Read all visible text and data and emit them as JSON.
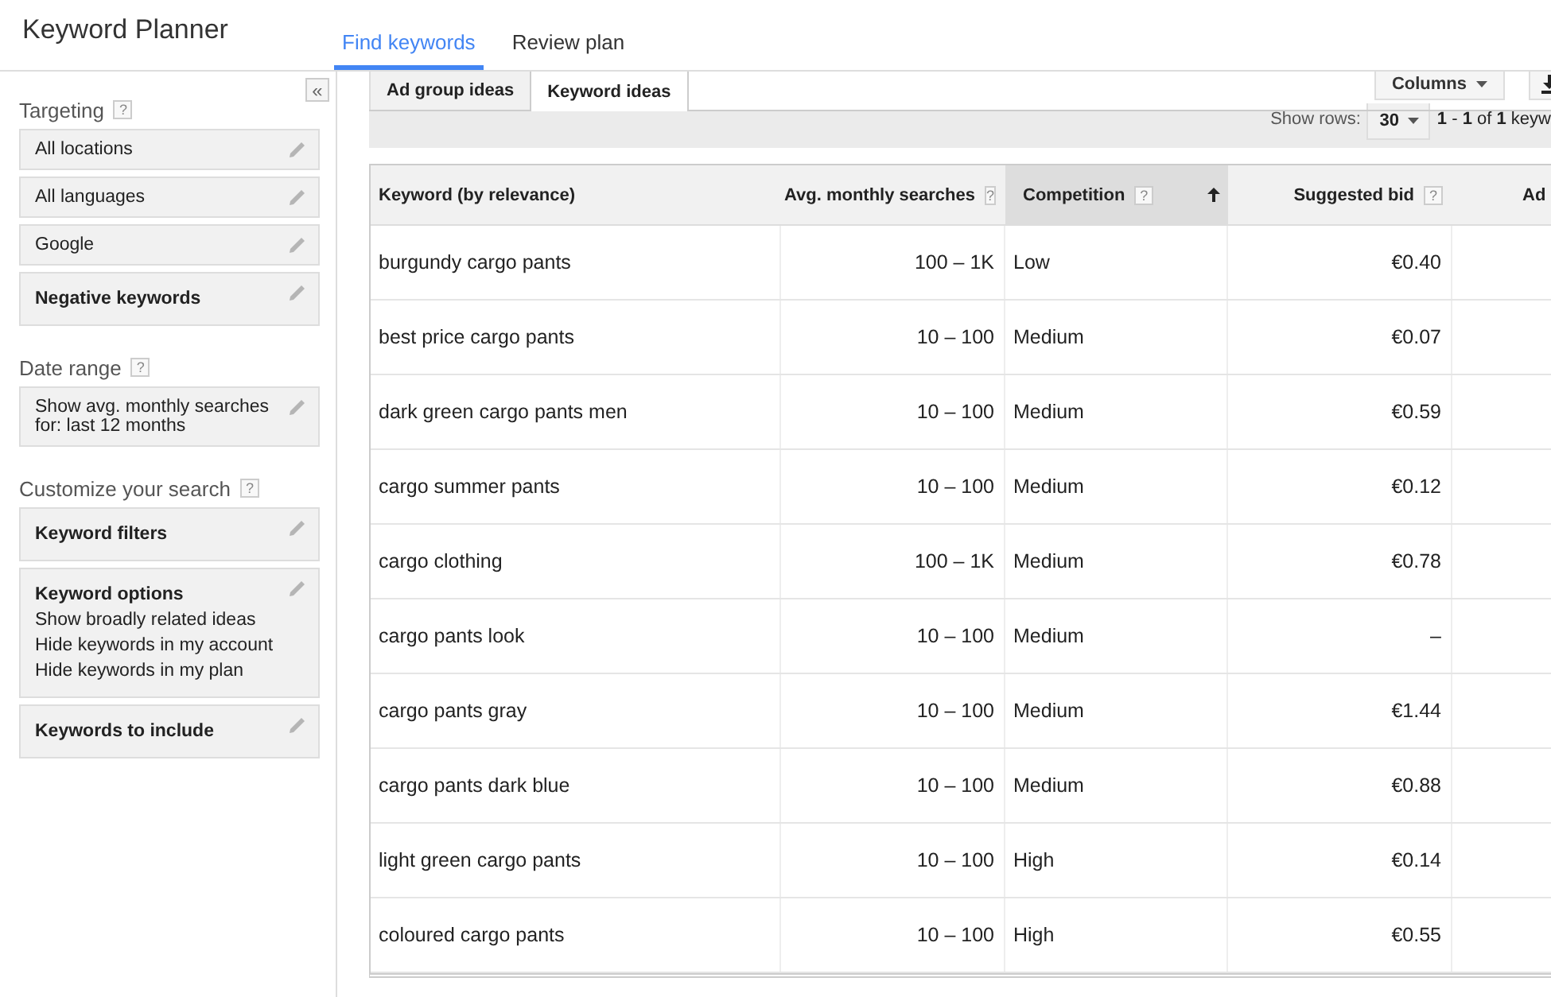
{
  "app_title": "Keyword Planner",
  "nav_tabs": [
    {
      "label": "Find keywords",
      "selected": true
    },
    {
      "label": "Review plan",
      "selected": false
    }
  ],
  "sidebar": {
    "collapse": "«",
    "sections": [
      {
        "heading": "Targeting",
        "help": "?",
        "cards": [
          {
            "kind": "value",
            "title": "All locations"
          },
          {
            "kind": "value",
            "title": "All languages"
          },
          {
            "kind": "value",
            "title": "Google"
          },
          {
            "kind": "option",
            "title": "Negative keywords"
          }
        ]
      },
      {
        "heading": "Date range",
        "help": "?",
        "cards": [
          {
            "kind": "value",
            "title": "Show avg. monthly searches for: last 12 months"
          }
        ]
      },
      {
        "heading": "Customize your search",
        "help": "?",
        "cards": [
          {
            "kind": "option",
            "title": "Keyword filters"
          },
          {
            "kind": "option",
            "title": "Keyword options",
            "lines": [
              "Show broadly related ideas",
              "Hide keywords in my account",
              "Hide keywords in my plan"
            ]
          },
          {
            "kind": "option",
            "title": "Keywords to include"
          }
        ]
      }
    ]
  },
  "result_tabs": [
    {
      "label": "Ad group ideas",
      "selected": false
    },
    {
      "label": "Keyword ideas",
      "selected": true
    }
  ],
  "toolbar": {
    "columns_button": "Columns",
    "show_rows_label": "Show rows:",
    "rows_value": "30",
    "range": "**1** - **1** of **1** keyw"
  },
  "table": {
    "columns": [
      {
        "label": "Keyword (by relevance)",
        "sorted": false
      },
      {
        "label": "Avg. monthly searches",
        "help": "?",
        "sorted": false
      },
      {
        "label": "Competition",
        "help": "?",
        "sorted": true
      },
      {
        "label": "Suggested bid",
        "help": "?",
        "sorted": false
      },
      {
        "label": "Ad",
        "sorted": false
      }
    ],
    "rows": [
      [
        "burgundy cargo pants",
        "100 – 1K",
        "Low",
        "€0.40"
      ],
      [
        "best price cargo pants",
        "10 – 100",
        "Medium",
        "€0.07"
      ],
      [
        "dark green cargo pants men",
        "10 – 100",
        "Medium",
        "€0.59"
      ],
      [
        "cargo summer pants",
        "10 – 100",
        "Medium",
        "€0.12"
      ],
      [
        "cargo clothing",
        "100 – 1K",
        "Medium",
        "€0.78"
      ],
      [
        "cargo pants look",
        "10 – 100",
        "Medium",
        "–"
      ],
      [
        "cargo pants gray",
        "10 – 100",
        "Medium",
        "€1.44"
      ],
      [
        "cargo pants dark blue",
        "10 – 100",
        "Medium",
        "€0.88"
      ],
      [
        "light green cargo pants",
        "10 – 100",
        "High",
        "€0.14"
      ],
      [
        "coloured cargo pants",
        "10 – 100",
        "High",
        "€0.55"
      ]
    ]
  }
}
